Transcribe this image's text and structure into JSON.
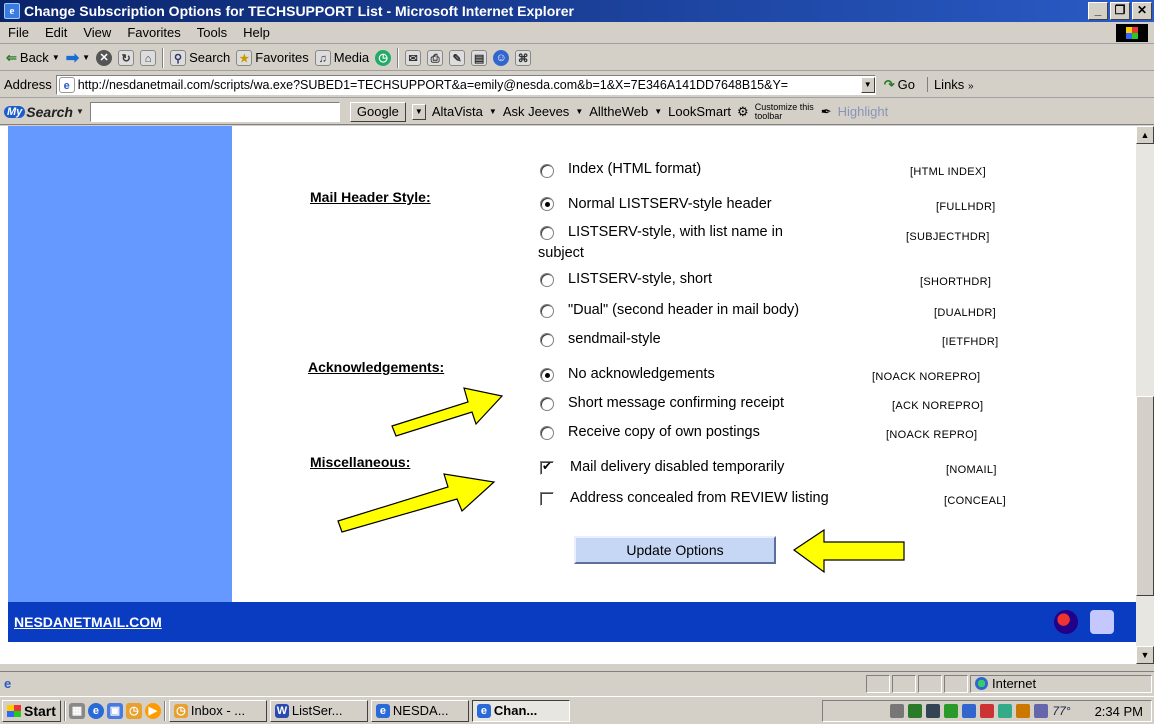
{
  "window": {
    "title": "Change Subscription Options for TECHSUPPORT List - Microsoft Internet Explorer",
    "minimize": "_",
    "restore": "❐",
    "close": "✕"
  },
  "menu": [
    "File",
    "Edit",
    "View",
    "Favorites",
    "Tools",
    "Help"
  ],
  "toolbar": {
    "back": "Back",
    "search": "Search",
    "favorites": "Favorites",
    "media": "Media"
  },
  "address": {
    "label": "Address",
    "url": "http://nesdanetmail.com/scripts/wa.exe?SUBED1=TECHSUPPORT&a=emily@nesda.com&b=1&X=7E346A141DD7648B15&Y=",
    "go": "Go",
    "links": "Links"
  },
  "searchbar": {
    "brand": "Search",
    "google": "Google",
    "altavista": "AltaVista",
    "askjeeves": "Ask Jeeves",
    "alltheweb": "AlltheWeb",
    "looksmart": "LookSmart",
    "customize": "Customize this toolbar",
    "highlight": "Highlight"
  },
  "form": {
    "index_option": {
      "label": "Index (HTML format)",
      "code": "[HTML INDEX]",
      "selected": false
    },
    "mail_header": {
      "label": "Mail Header Style:",
      "options": [
        {
          "label": "Normal LISTSERV-style header",
          "code": "[FULLHDR]",
          "selected": true
        },
        {
          "label": "LISTSERV-style, with list name in",
          "label2": "subject",
          "code": "[SUBJECTHDR]",
          "selected": false
        },
        {
          "label": "LISTSERV-style, short",
          "code": "[SHORTHDR]",
          "selected": false
        },
        {
          "label": "\"Dual\" (second header in mail body)",
          "code": "[DUALHDR]",
          "selected": false
        },
        {
          "label": "sendmail-style",
          "code": "[IETFHDR]",
          "selected": false
        }
      ]
    },
    "acknowledgements": {
      "label": "Acknowledgements:",
      "options": [
        {
          "label": "No acknowledgements",
          "code": "[NOACK NOREPRO]",
          "selected": true
        },
        {
          "label": "Short message confirming receipt",
          "code": "[ACK NOREPRO]",
          "selected": false
        },
        {
          "label": "Receive copy of own postings",
          "code": "[NOACK REPRO]",
          "selected": false
        }
      ]
    },
    "miscellaneous": {
      "label": "Miscellaneous:",
      "options": [
        {
          "label": "Mail delivery disabled temporarily",
          "code": "[NOMAIL]",
          "checked": true
        },
        {
          "label": "Address concealed from REVIEW listing",
          "code": "[CONCEAL]",
          "checked": false
        }
      ]
    },
    "update_button": "Update Options"
  },
  "footer": {
    "link": "NESDANETMAIL.COM"
  },
  "status": {
    "zone": "Internet"
  },
  "taskbar": {
    "start": "Start",
    "tasks": [
      "Inbox - ...",
      "ListSer...",
      "NESDA...",
      "Chan..."
    ],
    "clock": "2:34 PM",
    "temp": "77°"
  },
  "colors": {
    "accent_blue": "#6699ff",
    "footer_blue": "#0a3cc2",
    "arrow_yellow": "#ffff00"
  }
}
